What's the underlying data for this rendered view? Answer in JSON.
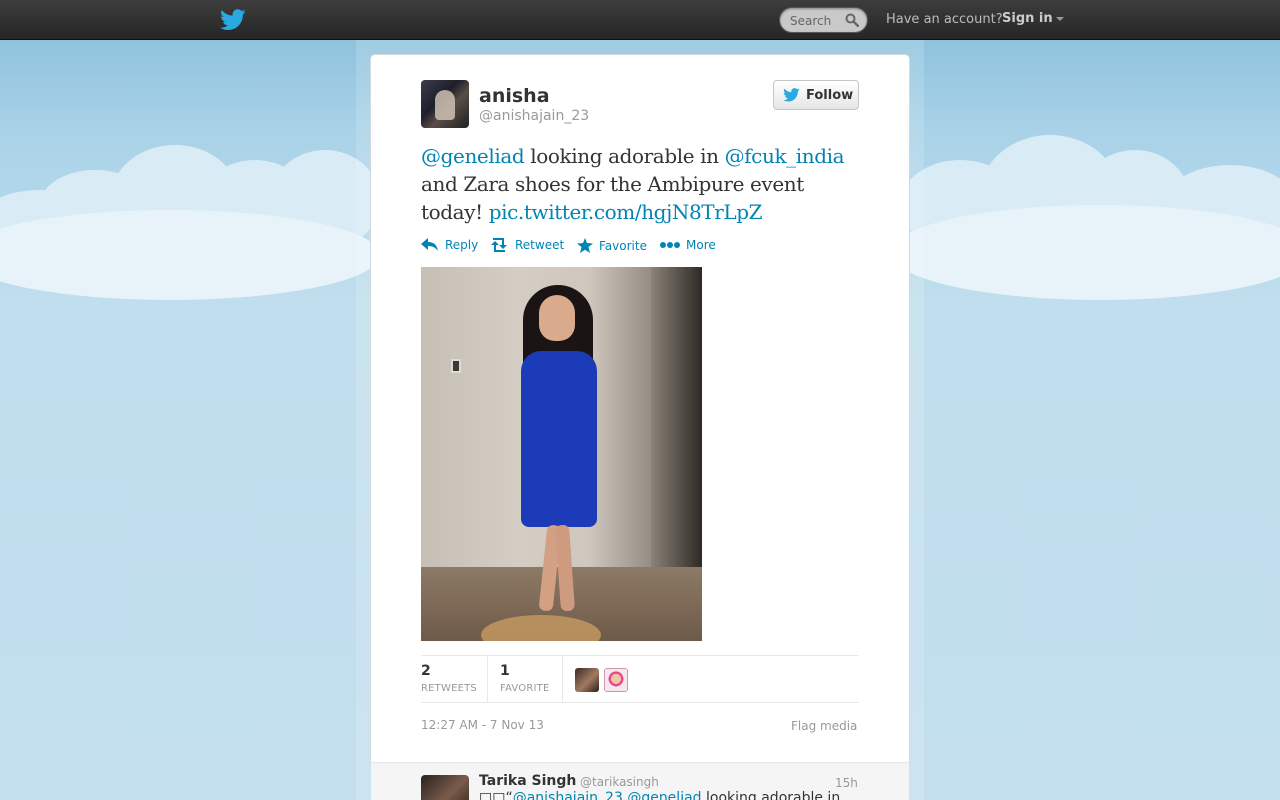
{
  "topbar": {
    "search_placeholder": "Search",
    "have_account": "Have an account?",
    "sign_in": "Sign in"
  },
  "tweet": {
    "author": {
      "name": "anisha",
      "handle": "@anishajain_23"
    },
    "follow_label": "Follow",
    "text_parts": {
      "mention1": "@geneliad",
      "t1": " looking adorable in ",
      "mention2": "@fcuk_india",
      "t2": " and Zara shoes for the Ambipure event today! ",
      "link": "pic.twitter.com/hgjN8TrLpZ"
    },
    "actions": {
      "reply": "Reply",
      "retweet": "Retweet",
      "favorite": "Favorite",
      "more": "More"
    },
    "stats": {
      "retweets_count": "2",
      "retweets_label": "RETWEETS",
      "favorites_count": "1",
      "favorites_label": "FAVORITE"
    },
    "timestamp": "12:27 AM - 7 Nov 13",
    "flag_media": "Flag media"
  },
  "reply": {
    "name": "Tarika Singh",
    "handle": "@tarikasingh",
    "time": "15h",
    "text_prefix": "□□“",
    "mention1": "@anishajain_23",
    "mention2": "@geneliad",
    "text_rest": " looking adorable in"
  },
  "colors": {
    "link": "#0084b4",
    "twitter_blue": "#1da1f2",
    "background": "#c0deed"
  }
}
